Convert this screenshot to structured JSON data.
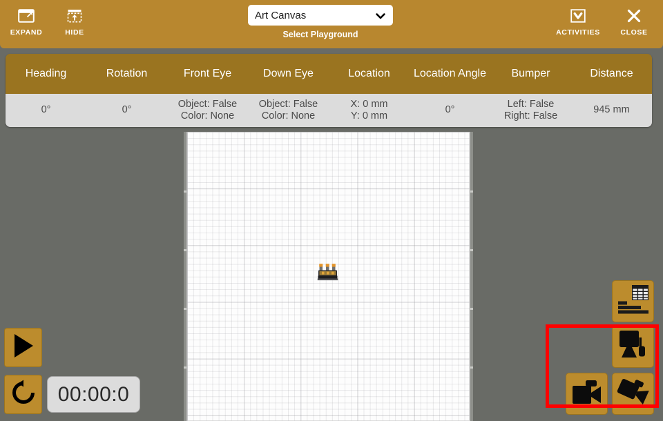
{
  "header": {
    "expand": {
      "label": "EXPAND",
      "icon": "expand-window-icon"
    },
    "hide": {
      "label": "HIDE",
      "icon": "hide-panel-icon"
    },
    "activities": {
      "label": "ACTIVITIES",
      "icon": "activities-dropdown-icon"
    },
    "close": {
      "label": "CLOSE",
      "icon": "close-x-icon"
    },
    "playground_select": {
      "value": "Art Canvas",
      "label": "Select Playground",
      "options": [
        "Art Canvas"
      ]
    },
    "background_color": "#b8872f"
  },
  "status_table": {
    "columns": [
      "Heading",
      "Rotation",
      "Front\nEye",
      "Down\nEye",
      "Location",
      "Location\nAngle",
      "Bumper",
      "Distance"
    ],
    "row": [
      "0°",
      "0°",
      "Object: False\nColor: None",
      "Object: False\nColor: None",
      "X: 0 mm\nY: 0 mm",
      "0°",
      "Left: False\nRight: False",
      "945 mm"
    ],
    "header_color": "#9a7420",
    "cell_color": "#dcdcdc"
  },
  "stage": {
    "robot": "robot-sprite",
    "grid": "graph-paper-grid"
  },
  "controls": {
    "play": {
      "icon": "play-icon"
    },
    "reset": {
      "icon": "reset-circular-arrow-icon"
    },
    "timer": {
      "value": "00:00:0"
    }
  },
  "tools": [
    {
      "name": "data-table-button",
      "icon": "data-table-icon"
    },
    {
      "name": "monitor-button",
      "icon": "monitor-icon"
    },
    {
      "name": "video-button",
      "icon": "video-camera-icon"
    },
    {
      "name": "camera-button",
      "icon": "camera-angle-icon"
    }
  ],
  "annotation": {
    "highlight_color": "#ff0000"
  },
  "colors": {
    "background": "#696b66",
    "gold": "#b8872f",
    "gold_dark": "#9a7420",
    "button_gold": "#bc8c2d"
  }
}
